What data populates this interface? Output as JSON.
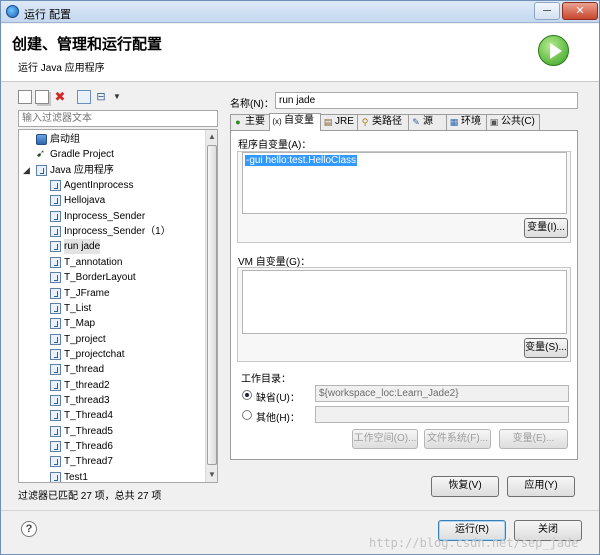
{
  "window": {
    "title": "运行 配置",
    "minimize_label": "─",
    "close_label": "✕"
  },
  "header": {
    "title": "创建、管理和运行配置",
    "subtitle": "运行 Java 应用程序",
    "badge_icon": "run-play-icon"
  },
  "left": {
    "filter_placeholder": "输入过滤器文本",
    "toolbar_icons": [
      "new-config-icon",
      "duplicate-icon",
      "delete-icon",
      "filter-icon",
      "collapse-all-icon",
      "view-menu-icon"
    ],
    "tree": [
      {
        "label": "启动组",
        "icon": "launch-group-icon"
      },
      {
        "label": "Gradle Project",
        "icon": "gradle-icon"
      },
      {
        "label": "Java 应用程序",
        "icon": "java-app-icon",
        "expanded": true
      },
      {
        "label": "AgentInprocess"
      },
      {
        "label": "Hellojava"
      },
      {
        "label": "Inprocess_Sender"
      },
      {
        "label": "Inprocess_Sender（1）"
      },
      {
        "label": "run jade",
        "selected": true
      },
      {
        "label": "T_annotation"
      },
      {
        "label": "T_BorderLayout"
      },
      {
        "label": "T_JFrame"
      },
      {
        "label": "T_List"
      },
      {
        "label": "T_Map"
      },
      {
        "label": "T_project"
      },
      {
        "label": "T_projectchat"
      },
      {
        "label": "T_thread"
      },
      {
        "label": "T_thread2"
      },
      {
        "label": "T_thread3"
      },
      {
        "label": "T_Thread4"
      },
      {
        "label": "T_Thread5"
      },
      {
        "label": "T_Thread6"
      },
      {
        "label": "T_Thread7"
      },
      {
        "label": "Test1"
      }
    ],
    "status": "过滤器已匹配 27 项，总共 27 项"
  },
  "right": {
    "name_label": "名称(N)：",
    "name_value": "run jade",
    "tabs": [
      {
        "label": "主要",
        "icon": "main-tab-icon"
      },
      {
        "label": "自变量",
        "icon": "args-tab-icon",
        "active": true
      },
      {
        "label": "JRE",
        "icon": "jre-tab-icon"
      },
      {
        "label": "类路径",
        "icon": "classpath-tab-icon"
      },
      {
        "label": "源",
        "icon": "source-tab-icon"
      },
      {
        "label": "环境",
        "icon": "env-tab-icon"
      },
      {
        "label": "公共(C)",
        "icon": "common-tab-icon"
      }
    ],
    "program_args_label": "程序自变量(A)：",
    "program_args_value": "-gui hello:test.HelloClass",
    "variables_button": "变量(I)...",
    "vm_args_label": "VM 自变量(G)：",
    "vm_args_value": "",
    "vm_variables_button": "变量(S)...",
    "working_dir": {
      "label": "工作目录：",
      "default_label": "缺省(U)：",
      "default_value": "${workspace_loc:Learn_Jade2}",
      "other_label": "其他(H)：",
      "other_value": "",
      "workspace_button": "工作空间(O)...",
      "filesystem_button": "文件系统(F)...",
      "variables_button": "变量(E)..."
    },
    "revert_button": "恢复(V)",
    "apply_button": "应用(Y)"
  },
  "footer": {
    "help_label": "?",
    "run_button": "运行(R)",
    "close_button": "关闭",
    "watermark": "http://blog.csdn.net/sep_jade"
  }
}
